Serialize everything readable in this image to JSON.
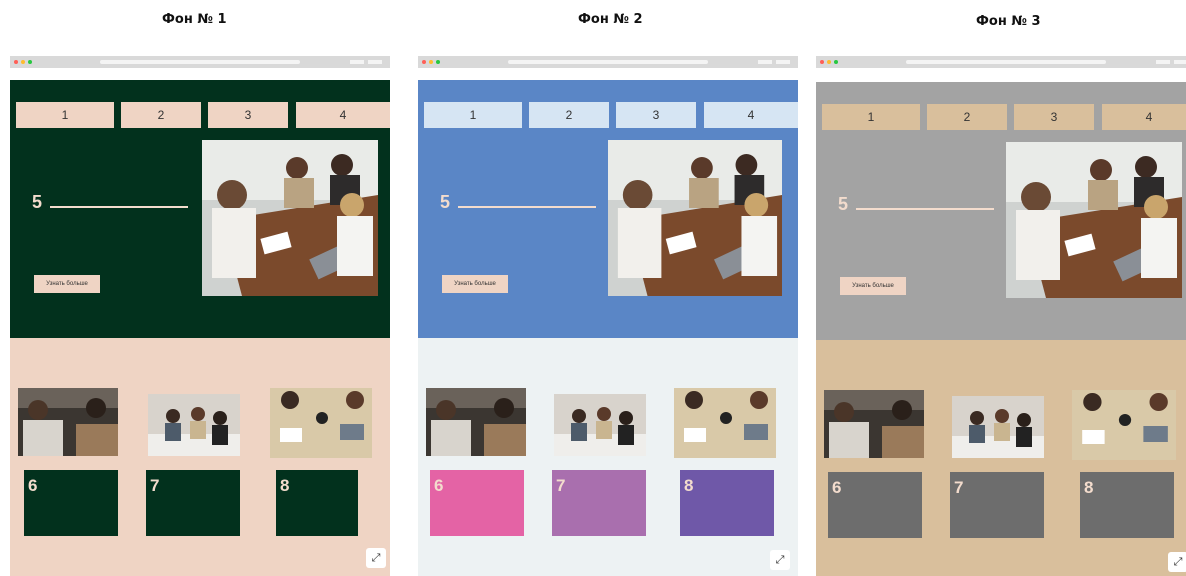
{
  "panels": [
    {
      "title": "Фон № 1",
      "nav": [
        "1",
        "2",
        "3",
        "4"
      ],
      "hero_number": "5",
      "button": "Узнать больше",
      "boxes": [
        "6",
        "7",
        "8"
      ],
      "colors": {
        "hero_bg": "#02311d",
        "nav_bg": "#efd4c4",
        "button_bg": "#efd4c4",
        "lower_bg": "#efd4c4",
        "boxes": [
          "#02311d",
          "#02311d",
          "#02311d"
        ],
        "box_text": "#f3dccd"
      }
    },
    {
      "title": "Фон № 2",
      "nav": [
        "1",
        "2",
        "3",
        "4"
      ],
      "hero_number": "5",
      "button": "Узнать больше",
      "boxes": [
        "6",
        "7",
        "8"
      ],
      "colors": {
        "hero_bg": "#5a86c6",
        "nav_bg": "#d6e5f3",
        "button_bg": "#efd4c4",
        "lower_bg": "#edf2f3",
        "boxes": [
          "#e463a5",
          "#a96fae",
          "#6f58a8"
        ],
        "box_text": "#f3dccd"
      }
    },
    {
      "title": "Фон № 3",
      "nav": [
        "1",
        "2",
        "3",
        "4"
      ],
      "hero_number": "5",
      "button": "Узнать больше",
      "boxes": [
        "6",
        "7",
        "8"
      ],
      "colors": {
        "hero_bg": "#a3a3a3",
        "nav_bg": "#d9bf9c",
        "button_bg": "#efd4c4",
        "lower_bg": "#d9bf9c",
        "boxes": [
          "#6d6d6d",
          "#6d6d6d",
          "#6d6d6d"
        ],
        "box_text": "#f3dccd"
      }
    }
  ],
  "icons": {
    "expand": "expand-icon",
    "window_dots": [
      "close-dot",
      "minimize-dot",
      "maximize-dot"
    ]
  }
}
